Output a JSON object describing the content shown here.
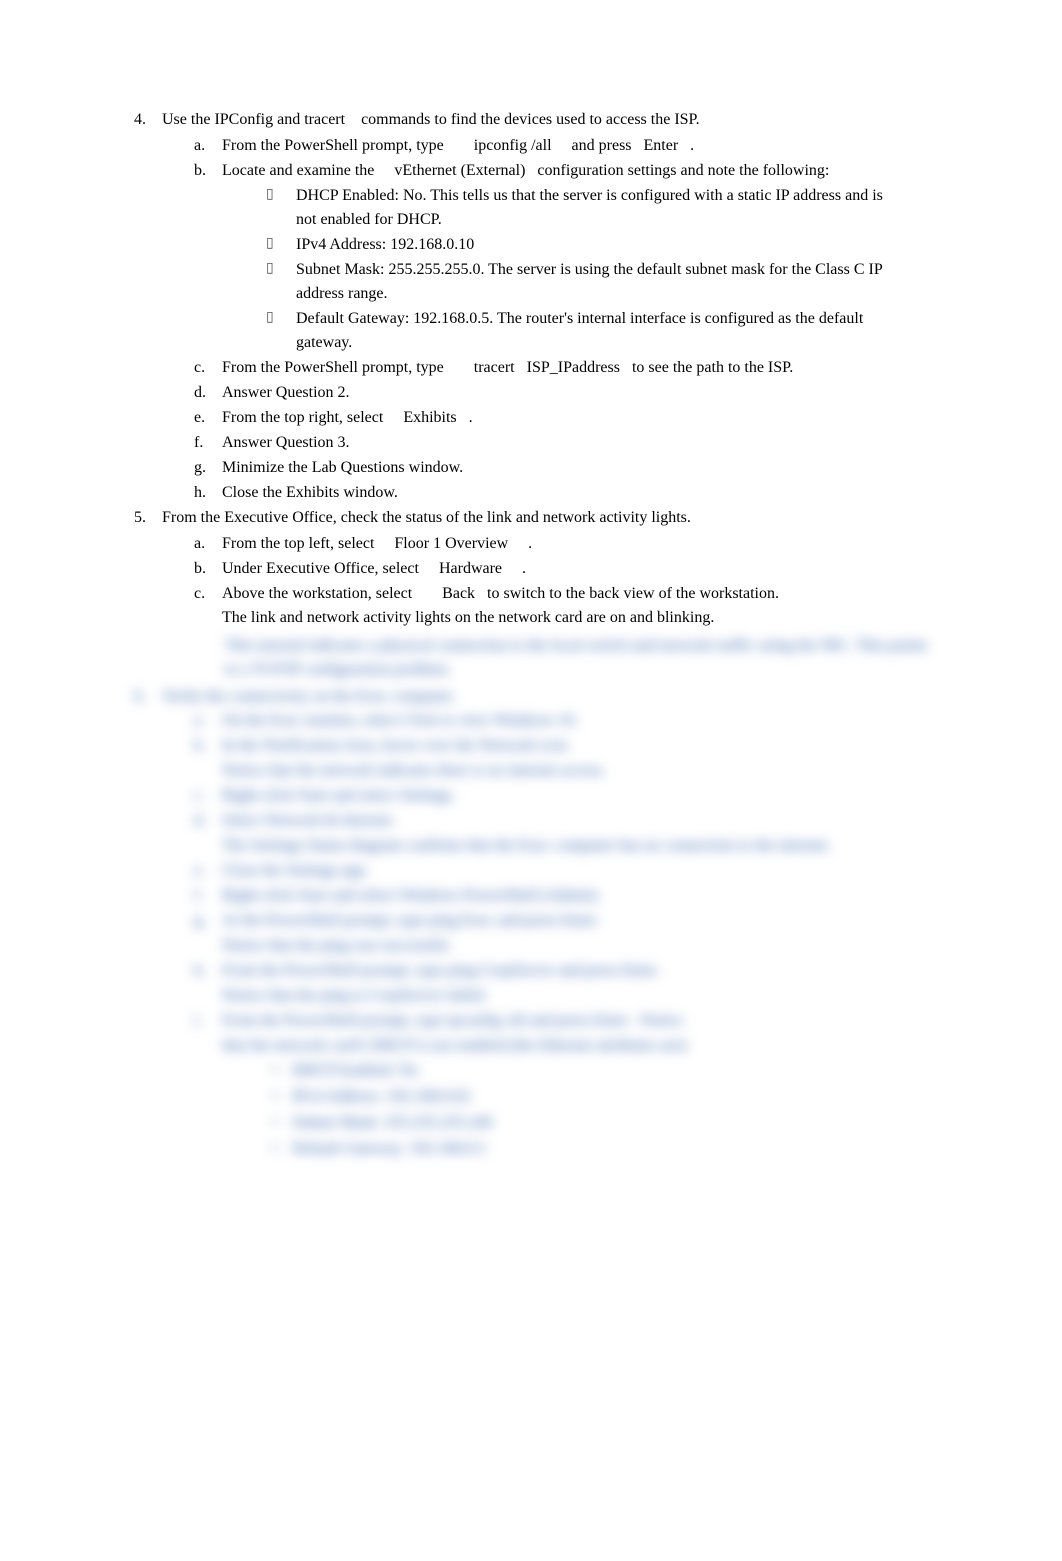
{
  "step4": {
    "num": "4.",
    "intro_a": "Use the ",
    "intro_cmd1": "IPConfig",
    "intro_b": " and ",
    "intro_cmd2": "tracert",
    "intro_c": " commands to find the devices used to access the ISP.",
    "items": [
      {
        "letter": "a.",
        "parts": [
          "From the PowerShell prompt, type",
          "ipconfig /all",
          "and press",
          "Enter",
          "."
        ]
      },
      {
        "letter": "b.",
        "parts": [
          "Locate and examine the",
          "vEthernet (External)",
          "configuration settings and note the following:"
        ],
        "bullets": [
          "DHCP Enabled: No. This tells us that the server is configured with a static IP address and is not enabled for DHCP.",
          "IPv4 Address: 192.168.0.10",
          "Subnet Mask: 255.255.255.0. The server is using the default subnet mask for the Class C IP address range.",
          "Default Gateway: 192.168.0.5. The router's internal interface is configured as the default gateway."
        ]
      },
      {
        "letter": "c.",
        "parts": [
          "From the PowerShell prompt, type",
          "tracert",
          "ISP_IPaddress",
          "to see the path to the ISP."
        ]
      },
      {
        "letter": "d.",
        "text": "Answer Question 2."
      },
      {
        "letter": "e.",
        "parts": [
          "From the top right, select",
          "Exhibits",
          "."
        ]
      },
      {
        "letter": "f.",
        "text": "Answer Question 3."
      },
      {
        "letter": "g.",
        "text": "Minimize the Lab Questions window."
      },
      {
        "letter": "h.",
        "text": "Close the Exhibits window."
      }
    ]
  },
  "step5": {
    "num": "5.",
    "intro": "From the Executive Office, check the status of the link and network activity lights.",
    "items": [
      {
        "letter": "a.",
        "parts": [
          "From the top left, select",
          "Floor 1 Overview",
          "."
        ]
      },
      {
        "letter": "b.",
        "parts": [
          "Under Executive Office, select",
          "Hardware",
          "."
        ]
      },
      {
        "letter": "c.",
        "parts": [
          "Above the workstation, select",
          "Back",
          "to switch to the back view of the workstation."
        ],
        "extra": "The link and network activity lights on the network card are on and blinking."
      }
    ]
  },
  "hidden": {
    "line1": "This tutorial indicates a physical connection to the local switch and network traffic using the NIC. This points to a TCP/IP configuration problem.",
    "step_num": "6.",
    "step_text": "Verify the connectivity on the Exec computer.",
    "subs": [
      {
        "letter": "a.",
        "text": "On the Exec monitor, select     Click to view Windows 10."
      },
      {
        "letter": "b.",
        "text": "In the Notification Area, hover over the     Network     icon."
      },
      {
        "letter": "",
        "text": "Notice that the network indicates there is no internet access."
      },
      {
        "letter": "c.",
        "text": "Right-click     Start     and select     Settings."
      },
      {
        "letter": "d.",
        "text": "Select     Network & Internet."
      },
      {
        "letter": "",
        "text": "The Settings Status diagram confirms that the Exec computer has no connection to the internet."
      },
      {
        "letter": "e.",
        "text": "Close the Settings app."
      },
      {
        "letter": "f.",
        "text": "Right-click     Start     and select     Windows PowerShell (Admin)."
      },
      {
        "letter": "g.",
        "text": "At the PowerShell prompt, type     ping Exec     and press     Enter."
      },
      {
        "letter": "",
        "text": "Notice that the ping was successful."
      },
      {
        "letter": "h.",
        "text": "From the PowerShell prompt, type     ping CorpServer     and press     Enter."
      },
      {
        "letter": "",
        "text": "Notice that the ping to CorpServer failed."
      },
      {
        "letter": "i.",
        "text": "From the PowerShell prompt, type     ipconfig /all     and press Enter     . Notice"
      },
      {
        "letter": "",
        "text": "that the network card's DHCP is not enabled (the Ethernet attributes are):"
      }
    ],
    "bullets": [
      "DHCP Enabled: No",
      "IPv4 Address: 192.168.0.62",
      "Subnet Mask: 255.255.255.240",
      "Default Gateway: 192.168.0.5"
    ]
  }
}
